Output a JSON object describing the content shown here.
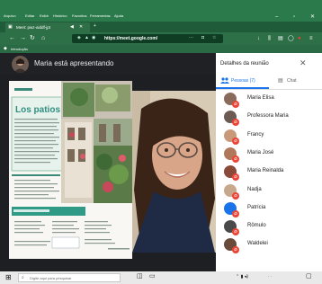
{
  "browser": {
    "menu": [
      "Arquivo",
      "Editar",
      "Exibir",
      "Histórico",
      "Favoritos",
      "Ferramentas",
      "Ajuda"
    ],
    "tab_title": "Meet: pwz-aiddf-jpt",
    "url": "https://meet.google.com/",
    "bookmark": "Introdução"
  },
  "presentation": {
    "banner_text": "Maria está apresentando",
    "slide_title": "Los patios"
  },
  "panel": {
    "title": "Detalhes da reunião",
    "tab_people": "Pessoas (7)",
    "tab_chat": "Chat",
    "participants": [
      {
        "name": "Maria Elisa",
        "color": "#8a6a5a"
      },
      {
        "name": "Professora Maria",
        "color": "#6b5a52"
      },
      {
        "name": "Francy",
        "color": "#c89a7a"
      },
      {
        "name": "Maria José",
        "color": "#b0785a"
      },
      {
        "name": "Maria Reinalda",
        "color": "#8a4a3a"
      },
      {
        "name": "Nadja",
        "color": "#c8a88a"
      },
      {
        "name": "Patrícia",
        "color": "#1a73e8"
      },
      {
        "name": "Rômulo",
        "color": "#4a4a4a"
      },
      {
        "name": "Waldelei",
        "color": "#6a4a3a"
      }
    ]
  },
  "taskbar": {
    "search_placeholder": "Digite aqui para pesquisar"
  }
}
